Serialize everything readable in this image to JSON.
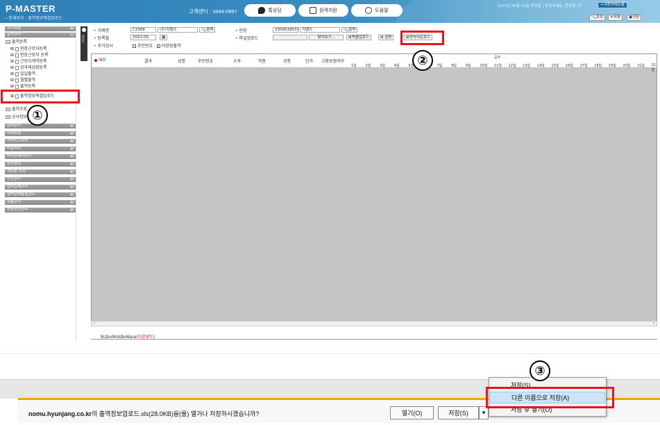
{
  "header": {
    "logo": "P-MASTER",
    "breadcrumb": "› 현재위치 : 출역정보엑셀업로드",
    "call_center": "고객센터 : 1644-0997",
    "buttons": {
      "chat": "톡상담",
      "remote": "원격지원",
      "help": "도움말"
    },
    "greeting": "2020년 09월 03일 목요일 | 안녕하세요. 환영합니다",
    "my_menu": "+사용자메뉴몰",
    "tools": {
      "search": "조회",
      "delete": "삭제",
      "save": "저장"
    }
  },
  "sidebar": {
    "sections_top": [
      {
        "label": "공지사항"
      },
      {
        "label": "출역관리"
      }
    ],
    "tree": [
      {
        "label": "출역등록",
        "type": "folder"
      },
      {
        "label": "현장근로자등록",
        "type": "doc"
      },
      {
        "label": "현장근로자 등록",
        "type": "doc"
      },
      {
        "label": "근로자계약등록",
        "type": "doc"
      },
      {
        "label": "상과재검험등록",
        "type": "doc"
      },
      {
        "label": "일일출역",
        "type": "doc"
      },
      {
        "label": "월별출역",
        "type": "doc"
      },
      {
        "label": "출역등록",
        "type": "doc"
      },
      {
        "label": "출역정보엑셀업로드",
        "type": "doc"
      },
      {
        "label": "출역조회",
        "type": "folder"
      },
      {
        "label": "공사정보",
        "type": "folder"
      }
    ],
    "sections_bottom": [
      {
        "label": "급여관리"
      },
      {
        "label": "사회보험"
      },
      {
        "label": "기타신고서식"
      },
      {
        "label": "마감처리"
      },
      {
        "label": "퇴직공제회관리"
      },
      {
        "label": "환경설정"
      },
      {
        "label": "게시판 조회"
      },
      {
        "label": "안전관리"
      },
      {
        "label": "협력업체관리"
      },
      {
        "label": "협력업체통합관리"
      },
      {
        "label": "공통관리"
      },
      {
        "label": "현장안전관리"
      }
    ]
  },
  "search": {
    "company_label": "거래명",
    "company_code": "C2308",
    "company_name": "(주)지엠스",
    "search_btn": "검색",
    "site_label": "현장",
    "site_code": "3300018537",
    "site_name": "지엠스",
    "month_label": "등록월",
    "month_value": "2021-09",
    "upload_label": "파일업로드",
    "browse_btn": "찾아보기...",
    "excel_upload_btn": "엑셀업로드",
    "verify_btn": "검증",
    "template_download_btn": "양식다운로드",
    "extra_label": "추가검사",
    "check_rrn": "주민번호",
    "check_other": "타현장출역"
  },
  "grid": {
    "columns": [
      "NO",
      "결과",
      "성명",
      "주민번호",
      "소속",
      "직종",
      "공종",
      "단가",
      "고용보험여부"
    ],
    "group_header": "공수",
    "days": [
      "1일",
      "2일",
      "3일",
      "4일",
      "5일",
      "6일",
      "7일",
      "8일",
      "9일",
      "10일",
      "11일",
      "12일",
      "13일",
      "14일",
      "15일",
      "16일",
      "17일",
      "18일",
      "19일",
      "20일",
      "21일",
      "22일"
    ]
  },
  "footer": {
    "text": "BizboMiddleWare(",
    "link": "다운로드",
    "close": ")"
  },
  "download": {
    "site": "nomu.hyunjang.co.kr",
    "message": "의 출역정보업로드.xls(28.0KB)을(를) 열거나 저장하시겠습니까?",
    "file_bold": "출역정보업로드.xls",
    "open_btn": "열기(O)",
    "save_btn": "저장(S)",
    "menu": [
      "저장(S)",
      "다른 이름으로 저장(A)",
      "저장 후 열기(O)"
    ]
  },
  "annotations": [
    "①",
    "②",
    "③"
  ]
}
